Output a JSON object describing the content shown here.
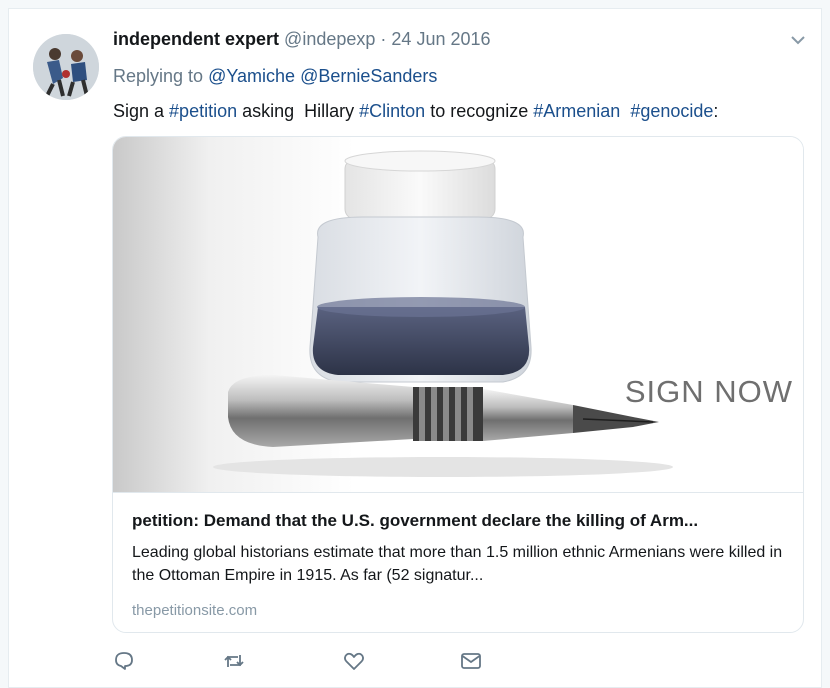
{
  "tweet": {
    "display_name": "independent expert",
    "handle": "@indepexp",
    "separator": "·",
    "timestamp": "24 Jun 2016",
    "reply_prefix": "Replying to",
    "reply_mentions": [
      "@Yamiche",
      "@BernieSanders"
    ],
    "text": {
      "part1": "Sign a ",
      "hashtag1": "#petition",
      "part2": " asking  Hillary ",
      "hashtag2": "#Clinton",
      "part3": " to recognize ",
      "hashtag3": "#Armenian",
      "part4": "  ",
      "hashtag4": "#genocide",
      "part5": ":"
    },
    "card": {
      "image_overlay_text": "SIGN NOW",
      "title": "petition: Demand that the U.S. government declare the killing of Arm...",
      "description": "Leading global historians estimate that more than 1.5 million ethnic Armenians were killed in the Ottoman Empire in 1915. As far (52 signatur...",
      "domain": "thepetitionsite.com"
    },
    "actions": [
      "reply-icon",
      "retweet-icon",
      "like-icon",
      "message-icon"
    ],
    "colors": {
      "link": "#1b4f8c",
      "secondary_text": "#657786",
      "icon": "#657786"
    }
  }
}
